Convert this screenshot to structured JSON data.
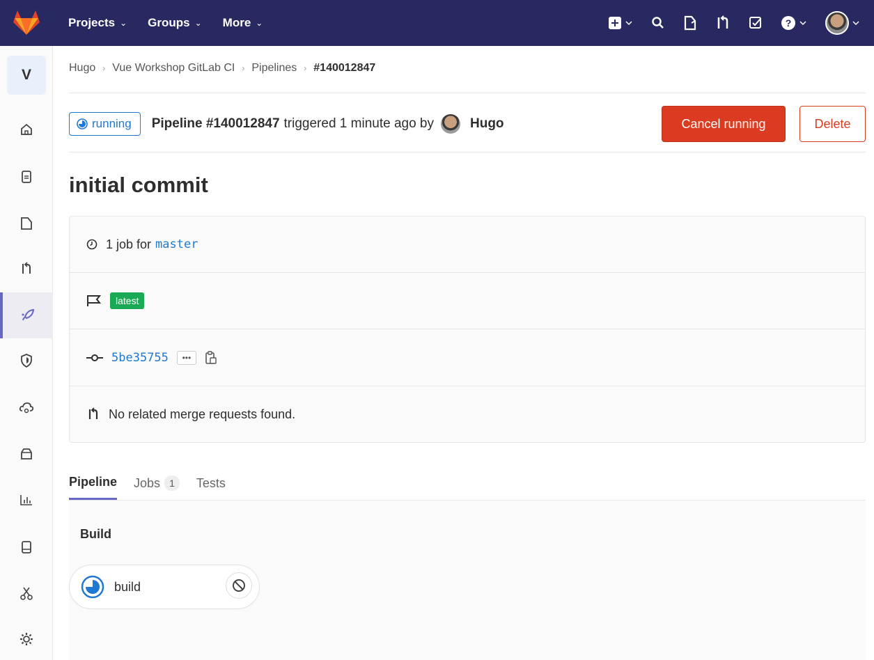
{
  "topnav": {
    "projects": "Projects",
    "groups": "Groups",
    "more": "More"
  },
  "sidebar": {
    "project_letter": "V"
  },
  "breadcrumb": [
    "Hugo",
    "Vue Workshop GitLab CI",
    "Pipelines",
    "#140012847"
  ],
  "header": {
    "status": "running",
    "pipeline_label": "Pipeline #140012847",
    "triggered_text": "triggered 1 minute ago by",
    "user": "Hugo",
    "cancel_label": "Cancel running",
    "delete_label": "Delete"
  },
  "commit_title": "initial commit",
  "info": {
    "jobs_text": "1 job for",
    "branch": "master",
    "badge": "latest",
    "sha": "5be35755",
    "ellipsis": "•••",
    "mr_text": "No related merge requests found."
  },
  "tabs": {
    "pipeline": "Pipeline",
    "jobs": "Jobs",
    "jobs_count": "1",
    "tests": "Tests"
  },
  "graph": {
    "stage": "Build",
    "job": "build"
  },
  "colors": {
    "nav_bg": "#292961",
    "accent": "#1f78d1",
    "danger": "#db3b21",
    "success": "#1aaa55",
    "active_tab": "#6666c4"
  }
}
